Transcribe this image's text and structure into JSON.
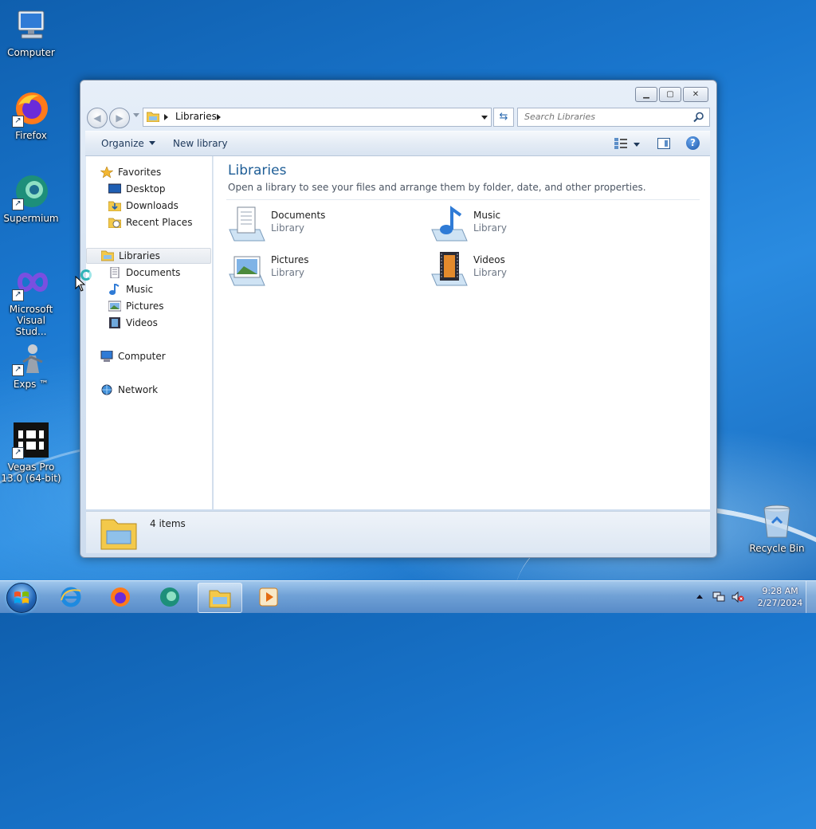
{
  "desktop": {
    "icons": [
      {
        "label": "Computer"
      },
      {
        "label": "Firefox"
      },
      {
        "label": "Supermium"
      },
      {
        "label": "Microsoft Visual Stud..."
      },
      {
        "label": "Exps ™"
      },
      {
        "label": "Vegas Pro 13.0 (64-bit)"
      },
      {
        "label": "Recycle Bin"
      }
    ]
  },
  "window": {
    "address": {
      "crumb": "Libraries"
    },
    "search": {
      "placeholder": "Search Libraries"
    },
    "toolbar": {
      "organize": "Organize",
      "new_library": "New library"
    },
    "nav": {
      "favorites": "Favorites",
      "desktop": "Desktop",
      "downloads": "Downloads",
      "recent": "Recent Places",
      "libraries": "Libraries",
      "documents": "Documents",
      "music": "Music",
      "pictures": "Pictures",
      "videos": "Videos",
      "computer": "Computer",
      "network": "Network"
    },
    "content": {
      "title": "Libraries",
      "subtitle": "Open a library to see your files and arrange them by folder, date, and other properties.",
      "libraries": [
        {
          "name": "Documents",
          "type": "Library"
        },
        {
          "name": "Music",
          "type": "Library"
        },
        {
          "name": "Pictures",
          "type": "Library"
        },
        {
          "name": "Videos",
          "type": "Library"
        }
      ]
    },
    "details": {
      "count": "4 items"
    }
  },
  "taskbar": {
    "clock": {
      "time": "9:28 AM",
      "date": "2/27/2024"
    }
  },
  "colors": {
    "accent": "#1e5d96",
    "taskbar": "#5a8cc8"
  }
}
